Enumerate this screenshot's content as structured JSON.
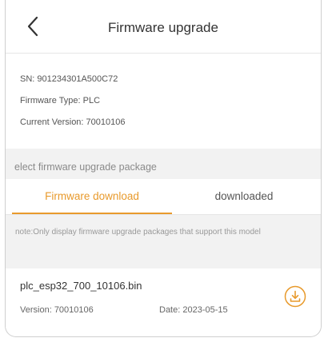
{
  "header": {
    "title": "Firmware upgrade"
  },
  "device": {
    "sn_label": "SN:",
    "sn_value": "901234301A500C72",
    "type_label": "Firmware Type:",
    "type_value": "PLC",
    "version_label": "Current Version:",
    "version_value": "70010106"
  },
  "select_label": "elect firmware upgrade package",
  "tabs": [
    {
      "label": "Firmware download",
      "active": true
    },
    {
      "label": "downloaded",
      "active": false
    }
  ],
  "note": "note:Only display firmware upgrade packages that support this model",
  "packages": [
    {
      "name": "plc_esp32_700_10106.bin",
      "version_label": "Version:",
      "version": "70010106",
      "date_label": "Date:",
      "date": "2023-05-15"
    }
  ],
  "colors": {
    "accent": "#e89a2c",
    "text": "#333333",
    "muted": "#999999",
    "band": "#f2f2f2"
  },
  "icons": {
    "back": "chevron-left-icon",
    "download": "download-circle-icon"
  }
}
